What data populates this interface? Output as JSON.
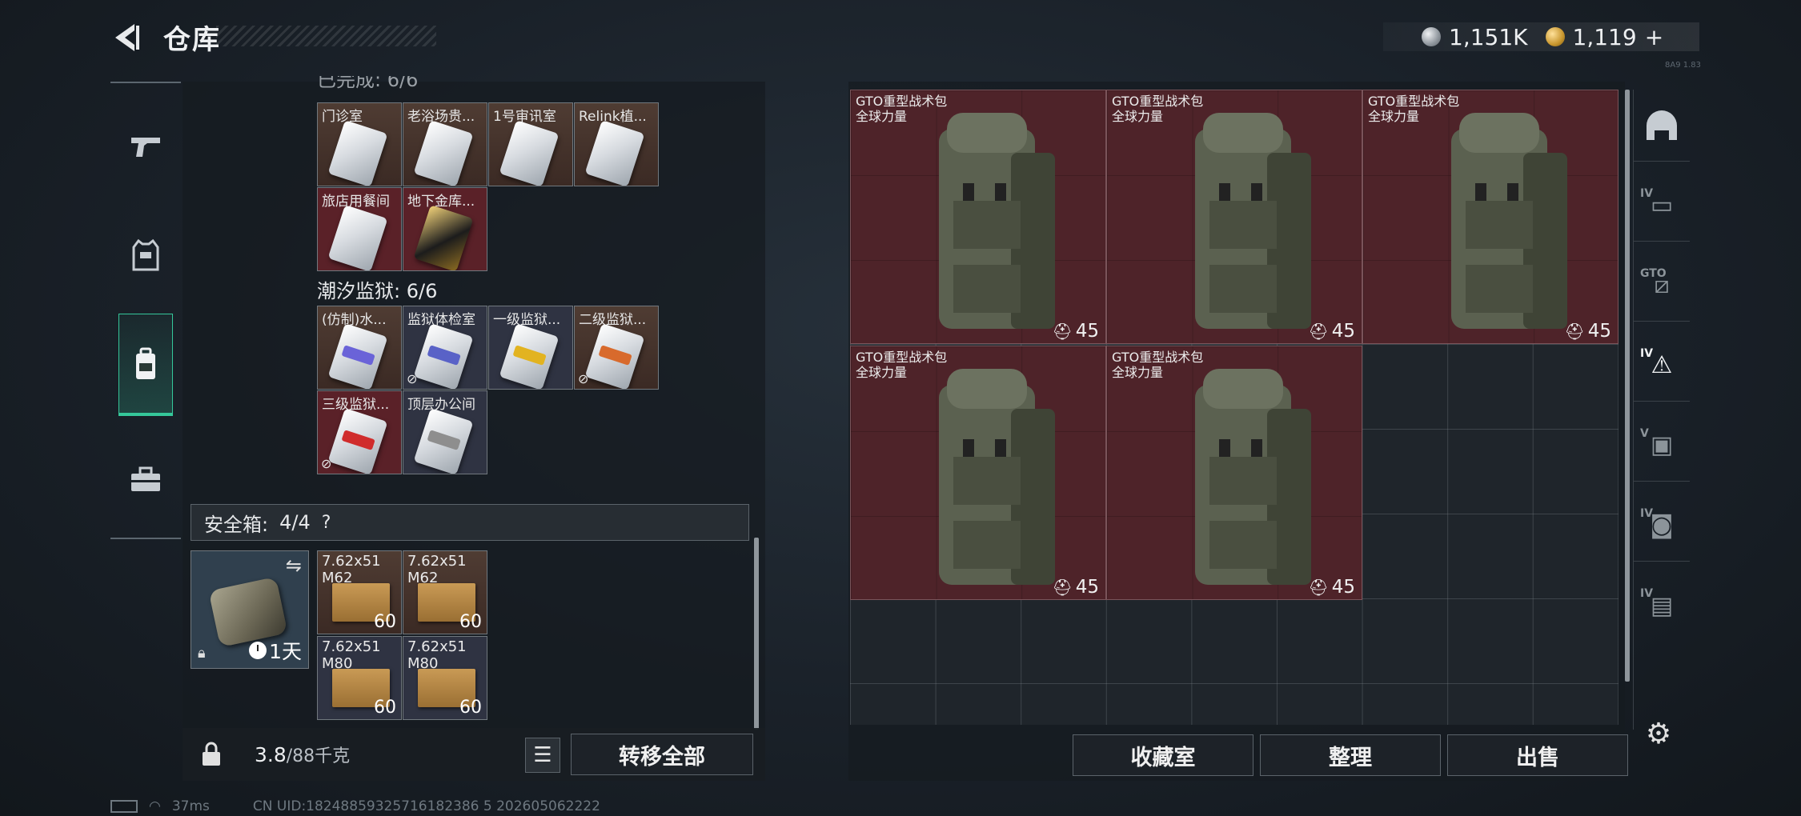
{
  "header": {
    "title": "仓库",
    "currency_silver": "1,151K",
    "currency_gold": "1,119",
    "currency_add": "+",
    "version": "8A9 1.83"
  },
  "left_nav": {
    "items": [
      {
        "name": "weapons",
        "icon": "gun-icon"
      },
      {
        "name": "equipment",
        "icon": "vest-icon"
      },
      {
        "name": "backpack",
        "icon": "backpack-icon",
        "active": true
      },
      {
        "name": "supplies",
        "icon": "toolbox-icon"
      }
    ]
  },
  "storage": {
    "section1_cut": "已完成: 6/6",
    "section1_items": [
      {
        "name": "门诊室",
        "color": "brown"
      },
      {
        "name": "老浴场贵...",
        "color": "brown"
      },
      {
        "name": "1号审讯室",
        "color": "brown"
      },
      {
        "name": "Relink植...",
        "color": "brown"
      },
      {
        "name": "旅店用餐间",
        "color": "red"
      },
      {
        "name": "地下金库...",
        "color": "red",
        "gold": true
      }
    ],
    "section2_title": "潮汐监狱: 6/6",
    "section2_items": [
      {
        "name": "(仿制)水...",
        "color": "brown",
        "stripe": "#6a63d8"
      },
      {
        "name": "监狱体检室",
        "color": "dark",
        "stripe": "#5962c7",
        "no_transfer": true
      },
      {
        "name": "一级监狱...",
        "color": "dark",
        "stripe": "#e2b320"
      },
      {
        "name": "二级监狱...",
        "color": "brown",
        "stripe": "#d86a2c",
        "no_transfer": true
      },
      {
        "name": "三级监狱...",
        "color": "red",
        "stripe": "#d02c2c",
        "no_transfer": true
      },
      {
        "name": "顶层办公间",
        "color": "dark",
        "stripe": "#8e8e8e"
      }
    ]
  },
  "safe_box": {
    "label": "安全箱:",
    "count": "4/4",
    "help": "?",
    "timer": "1天",
    "ammo": [
      {
        "caliber": "7.62x51",
        "type": "M62",
        "count": "60",
        "color": "brown"
      },
      {
        "caliber": "7.62x51",
        "type": "M62",
        "count": "60",
        "color": "brown"
      },
      {
        "caliber": "7.62x51",
        "type": "M80",
        "count": "60",
        "color": "blue"
      },
      {
        "caliber": "7.62x51",
        "type": "M80",
        "count": "60",
        "color": "blue"
      }
    ]
  },
  "bottom_bar": {
    "weight_current": "3.8",
    "weight_capacity": "/88千克",
    "transfer_all": "转移全部"
  },
  "warehouse": {
    "bags": [
      {
        "name": "GTO重型战术包",
        "brand": "全球力量",
        "level": "45"
      },
      {
        "name": "GTO重型战术包",
        "brand": "全球力量",
        "level": "45"
      },
      {
        "name": "GTO重型战术包",
        "brand": "全球力量",
        "level": "45"
      },
      {
        "name": "GTO重型战术包",
        "brand": "全球力量",
        "level": "45"
      },
      {
        "name": "GTO重型战术包",
        "brand": "全球力量",
        "level": "45"
      }
    ],
    "buttons": {
      "collection": "收藏室",
      "organize": "整理",
      "sell": "出售"
    }
  },
  "right_nav": {
    "items": [
      {
        "tier": "",
        "icon": "helmet-icon"
      },
      {
        "tier": "IV",
        "icon": "rifle-case-icon"
      },
      {
        "tier": "GTO",
        "icon": "tier-box-icon"
      },
      {
        "tier": "IV",
        "icon": "warning-box-icon",
        "active": true
      },
      {
        "tier": "V",
        "icon": "safe-icon"
      },
      {
        "tier": "IV",
        "icon": "camera-icon"
      },
      {
        "tier": "IV",
        "icon": "folder-icon"
      }
    ]
  },
  "status_bar": {
    "ping": "37ms",
    "uid": "CN UID:18248859325716182386 5 202605062222"
  },
  "colors": {
    "accent": "#35c79a",
    "bag_bg": "#4e2329",
    "cell_brown": "#4f3c33",
    "cell_red": "#5a2128",
    "cell_dark": "#2f3342"
  }
}
